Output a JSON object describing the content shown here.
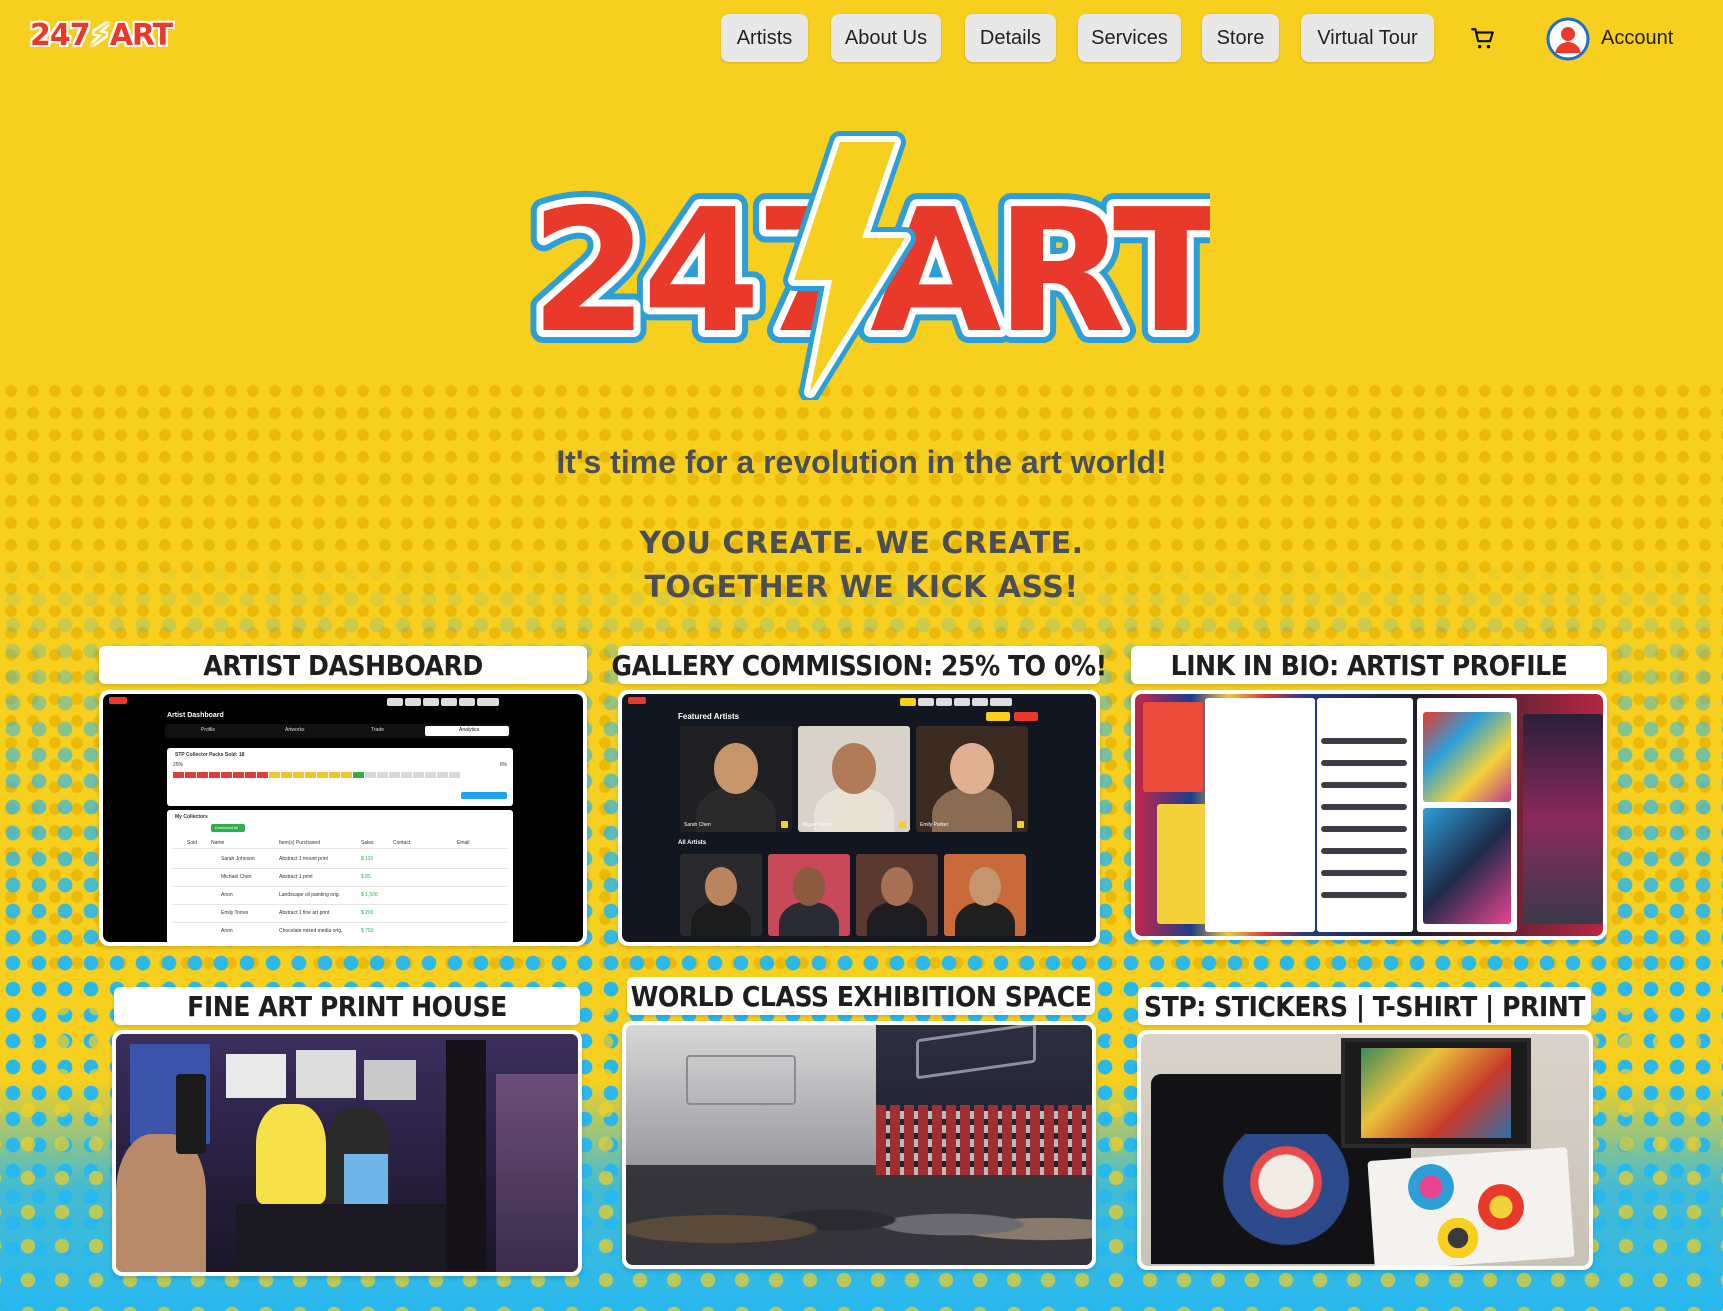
{
  "brand": {
    "logo_text_a": "247",
    "logo_text_b": "ART"
  },
  "nav": {
    "items": [
      {
        "label": "Artists"
      },
      {
        "label": "About Us"
      },
      {
        "label": "Details"
      },
      {
        "label": "Services"
      },
      {
        "label": "Store"
      },
      {
        "label": "Virtual Tour"
      }
    ],
    "account_label": "Account"
  },
  "hero": {
    "tagline": "It's time for a revolution in the art world!",
    "slogan_line1": "YOU CREATE. WE CREATE.",
    "slogan_line2": "TOGETHER WE KICK ASS!"
  },
  "cards": [
    {
      "title": "ARTIST DASHBOARD"
    },
    {
      "title": "GALLERY COMMISSION: 25% TO 0%!"
    },
    {
      "title": "LINK IN BIO: ARTIST PROFILE"
    },
    {
      "title": "FINE ART PRINT HOUSE"
    },
    {
      "title": "WORLD CLASS EXHIBITION SPACE"
    },
    {
      "title": "STP: STICKERS | T-SHIRT | PRINT"
    }
  ],
  "dashboard_mock": {
    "title": "Artist Dashboard",
    "tabs": [
      "Profile",
      "Artworks",
      "Trade",
      "Analytics"
    ],
    "progress_title": "STP Collector Packs Sold: 18",
    "progress_left": "25%",
    "progress_right": "0%",
    "collectors_title": "My Collectors",
    "download_label": "Download All",
    "columns": [
      "Sold",
      "Name",
      "Item(s) Purchased",
      "Sales",
      "Contact",
      "Email"
    ],
    "rows": [
      {
        "name": "Sarah Johnson",
        "item": "Abstract 1 mount print",
        "sales": "$ 110"
      },
      {
        "name": "Michael Chen",
        "item": "Abstract 1 print",
        "sales": "$ 85"
      },
      {
        "name": "Anon",
        "item": "Landscape oil painting orig.",
        "sales": "$ 1,500"
      },
      {
        "name": "Emily Torres",
        "item": "Abstract 1 fine art print",
        "sales": "$ 200"
      },
      {
        "name": "Anon",
        "item": "Chocolate mixed media orig.",
        "sales": "$ 750"
      }
    ],
    "palette": [
      "#e23b3b",
      "#e23b3b",
      "#e23b3b",
      "#e23b3b",
      "#e23b3b",
      "#e23b3b",
      "#e23b3b",
      "#e23b3b",
      "#f0c62a",
      "#f0c62a",
      "#f0c62a",
      "#f0c62a",
      "#f0c62a",
      "#f0c62a",
      "#f0c62a",
      "#2cae4a",
      "#d8d8d8",
      "#d8d8d8",
      "#d8d8d8",
      "#d8d8d8",
      "#d8d8d8",
      "#d8d8d8",
      "#d8d8d8",
      "#d8d8d8"
    ]
  },
  "featured_mock": {
    "heading": "Featured Artists",
    "subheading": "All Artists",
    "artists": [
      {
        "name": "Sarah Chen",
        "skin": "#c7956a",
        "shirt": "#2a2a2a",
        "bg": "#1f1f24"
      },
      {
        "name": "Miguel Torres",
        "skin": "#b07a58",
        "shirt": "#e8e2d6",
        "bg": "#d8d2c8"
      },
      {
        "name": "Emily Parker",
        "skin": "#e0b090",
        "shirt": "#8a6c52",
        "bg": "#3a2a22"
      }
    ],
    "thumbs": [
      {
        "skin": "#b88560",
        "shirt": "#1c1c1c",
        "bg": "#2a2a2e"
      },
      {
        "skin": "#8c5a3e",
        "shirt": "#2b2b35",
        "bg": "#c84a5a"
      },
      {
        "skin": "#a87052",
        "shirt": "#1e1e22",
        "bg": "#5a3a30"
      },
      {
        "skin": "#c79470",
        "shirt": "#202020",
        "bg": "#c86a3a"
      }
    ]
  },
  "colors": {
    "page_yellow": "#f6cf1f",
    "brand_red": "#e8392b",
    "sky_blue": "#28b8ee",
    "heading_gray": "#4a4e56"
  },
  "icons": [
    "cart-icon",
    "avatar-icon"
  ]
}
